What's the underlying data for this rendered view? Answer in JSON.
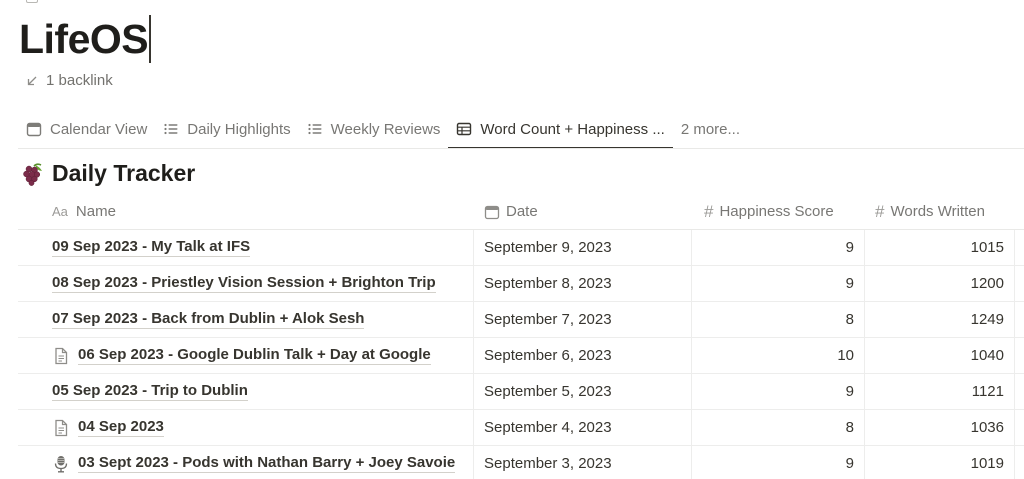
{
  "page": {
    "title": "LifeOS",
    "backlinks": "1 backlink"
  },
  "tabs": [
    {
      "label": "Calendar View",
      "icon": "calendar-icon"
    },
    {
      "label": "Daily Highlights",
      "icon": "list-icon"
    },
    {
      "label": "Weekly Reviews",
      "icon": "list-icon"
    },
    {
      "label": "Word Count + Happiness ...",
      "icon": "table-icon",
      "active": true
    },
    {
      "label": "2 more..."
    }
  ],
  "database": {
    "emoji": "grapes-icon",
    "title": "Daily Tracker",
    "columns": {
      "name": {
        "prefix": "Aa",
        "label": "Name"
      },
      "date": {
        "label": "Date"
      },
      "happiness": {
        "prefix": "#",
        "label": "Happiness Score"
      },
      "words": {
        "prefix": "#",
        "label": "Words Written"
      }
    },
    "rows": [
      {
        "name": "09 Sep 2023 - My Talk at IFS",
        "date": "September 9, 2023",
        "happiness": "9",
        "words": "1015",
        "icon": ""
      },
      {
        "name": "08 Sep 2023 - Priestley Vision Session + Brighton Trip",
        "date": "September 8, 2023",
        "happiness": "9",
        "words": "1200",
        "icon": ""
      },
      {
        "name": "07 Sep 2023 - Back from Dublin + Alok Sesh",
        "date": "September 7, 2023",
        "happiness": "8",
        "words": "1249",
        "icon": ""
      },
      {
        "name": "06 Sep 2023 - Google Dublin Talk + Day at Google",
        "date": "September 6, 2023",
        "happiness": "10",
        "words": "1040",
        "icon": "document-icon"
      },
      {
        "name": "05 Sep 2023 - Trip to Dublin",
        "date": "September 5, 2023",
        "happiness": "9",
        "words": "1121",
        "icon": ""
      },
      {
        "name": "04 Sep 2023",
        "date": "September 4, 2023",
        "happiness": "8",
        "words": "1036",
        "icon": "document-icon"
      },
      {
        "name": "03 Sept 2023 - Pods with Nathan Barry + Joey Savoie",
        "date": "September 3, 2023",
        "happiness": "9",
        "words": "1019",
        "icon": "microphone-icon"
      }
    ]
  }
}
